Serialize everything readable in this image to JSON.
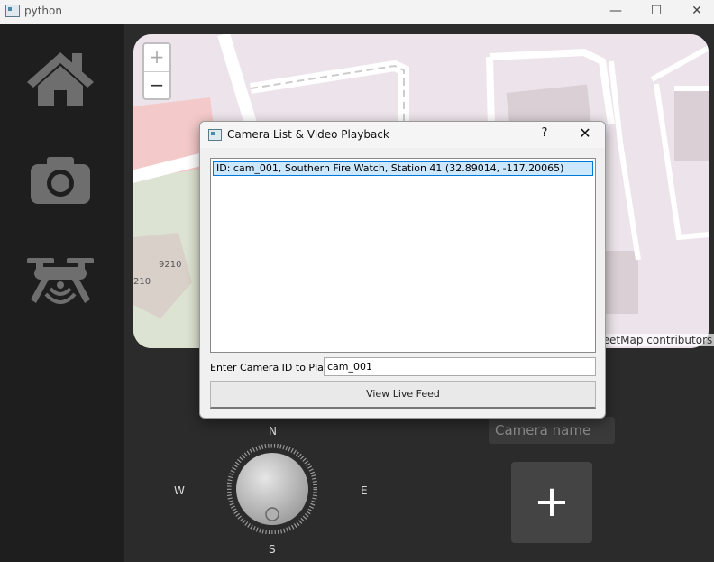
{
  "window": {
    "title": "python",
    "minimize_glyph": "—",
    "maximize_glyph": "☐",
    "close_glyph": "✕"
  },
  "sidebar": {
    "items": [
      {
        "name": "home",
        "icon": "home-icon"
      },
      {
        "name": "camera",
        "icon": "camera-icon"
      },
      {
        "name": "drone",
        "icon": "drone-icon"
      }
    ],
    "icon_color": "#6e6e6e"
  },
  "map": {
    "zoom_in": "+",
    "zoom_out": "−",
    "attribution": "reetMap contributors",
    "house_numbers": [
      "9210",
      "210"
    ]
  },
  "dialog": {
    "title": "Camera List & Video Playback",
    "help": "?",
    "close": "✕",
    "list_items": [
      "ID: cam_001, Southern Fire Watch, Station 41 (32.89014, -117.20065)"
    ],
    "camera_id_label": "Enter Camera ID to Play:",
    "camera_id_value": "cam_001",
    "view_button": "View Live Feed"
  },
  "controls": {
    "camera_name_placeholder": "Camera name",
    "add_button": "+",
    "compass": {
      "n": "N",
      "s": "S",
      "e": "E",
      "w": "W"
    }
  }
}
